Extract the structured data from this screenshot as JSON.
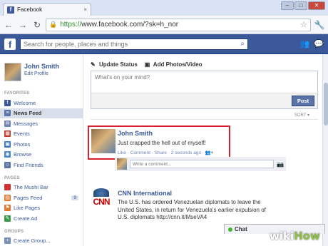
{
  "browser": {
    "tab_title": "Facebook",
    "tab_close": "×",
    "url_scheme": "https://",
    "url_rest": "www.facebook.com/?sk=h_nor"
  },
  "fb": {
    "logo": "f",
    "search_placeholder": "Search for people, places and things",
    "brand_color": "#3b5998"
  },
  "leftnav": {
    "user_name": "John Smith",
    "edit_profile": "Edit Profile",
    "favorites_header": "FAVORITES",
    "favorites": [
      {
        "label": "Welcome",
        "icon": "facebook-icon"
      },
      {
        "label": "News Feed",
        "icon": "news-feed-icon",
        "active": true
      },
      {
        "label": "Messages",
        "icon": "messages-icon"
      },
      {
        "label": "Events",
        "icon": "events-icon"
      },
      {
        "label": "Photos",
        "icon": "photos-icon"
      },
      {
        "label": "Browse",
        "icon": "browse-icon"
      },
      {
        "label": "Find Friends",
        "icon": "find-friends-icon"
      }
    ],
    "pages_header": "PAGES",
    "pages": [
      {
        "label": "The Mushi Bar",
        "icon": "page-icon"
      },
      {
        "label": "Pages Feed",
        "icon": "pages-feed-icon",
        "count": "9"
      },
      {
        "label": "Like Pages",
        "icon": "like-pages-icon"
      },
      {
        "label": "Create Ad",
        "icon": "create-ad-icon"
      }
    ],
    "groups_header": "GROUPS",
    "groups": [
      {
        "label": "Create Group...",
        "icon": "create-group-icon"
      }
    ]
  },
  "composer": {
    "update_status": "Update Status",
    "add_photos": "Add Photos/Video",
    "placeholder": "What's on your mind?",
    "post_button": "Post"
  },
  "feed": {
    "sort_label": "SORT ▾",
    "story1": {
      "name": "John Smith",
      "text": "Just crapped the hell out of myself!",
      "meta": "Like · Comment · Share · 2 seconds ago ·",
      "comment_placeholder": "Write a comment..."
    },
    "story2": {
      "name": "CNN International",
      "text": "The U.S. has ordered Venezuelan diplomats to leave the United States, in return for Venezuela's earlier expulsion of U.S. diplomats http://cnn.it/MseVA4",
      "logo_text": "CNN"
    }
  },
  "chat": {
    "label": "Chat"
  },
  "watermark": {
    "wiki": "wiki",
    "how": "How"
  }
}
